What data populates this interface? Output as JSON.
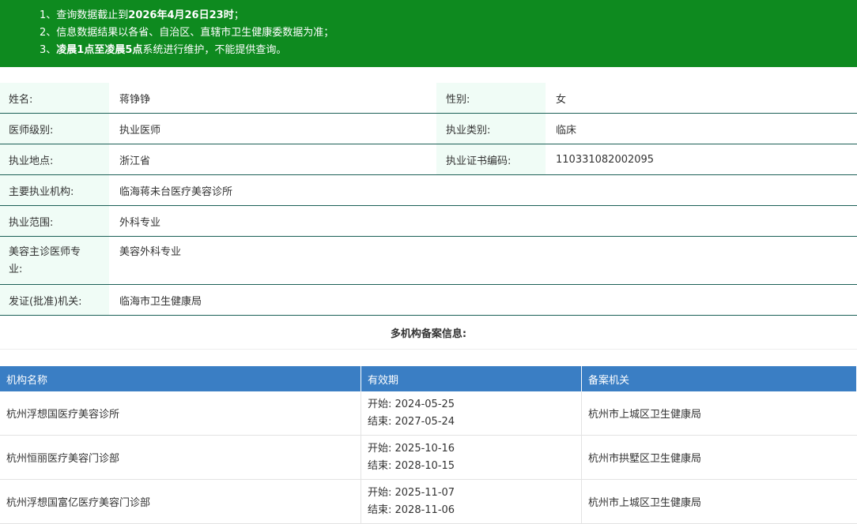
{
  "notice": {
    "line1_prefix": "1、查询数据截止到",
    "line1_bold": "2026年4月26日23时",
    "line1_suffix": "；",
    "line2": "2、信息数据结果以各省、自治区、直辖市卫生健康委数据为准；",
    "line3_prefix": "3、",
    "line3_bold": "凌晨1点至凌晨5点",
    "line3_suffix": "系统进行维护，不能提供查询。"
  },
  "info": {
    "name_label": "姓名:",
    "name_value": "蒋铮铮",
    "gender_label": "性别:",
    "gender_value": "女",
    "level_label": "医师级别:",
    "level_value": "执业医师",
    "category_label": "执业类别:",
    "category_value": "临床",
    "location_label": "执业地点:",
    "location_value": "浙江省",
    "cert_label": "执业证书编码:",
    "cert_value": "110331082002095",
    "org_label": "主要执业机构:",
    "org_value": "临海蒋未台医疗美容诊所",
    "scope_label": "执业范围:",
    "scope_value": "外科专业",
    "cosmetic_label": "美容主诊医师专业:",
    "cosmetic_value": "美容外科专业",
    "issuer_label": "发证(批准)机关:",
    "issuer_value": "临海市卫生健康局"
  },
  "multi": {
    "title": "多机构备案信息:",
    "headers": [
      "机构名称",
      "有效期",
      "备案机关"
    ],
    "rows": [
      {
        "name": "杭州浮想国医疗美容诊所",
        "start": "开始:  2024-05-25",
        "end": "结束:  2027-05-24",
        "authority": "杭州市上城区卫生健康局"
      },
      {
        "name": "杭州恒丽医疗美容门诊部",
        "start": "开始:  2025-10-16",
        "end": "结束:  2028-10-15",
        "authority": "杭州市拱墅区卫生健康局"
      },
      {
        "name": "杭州浮想国富亿医疗美容门诊部",
        "start": "开始:  2025-11-07",
        "end": "结束:  2028-11-06",
        "authority": "杭州市上城区卫生健康局"
      }
    ]
  }
}
